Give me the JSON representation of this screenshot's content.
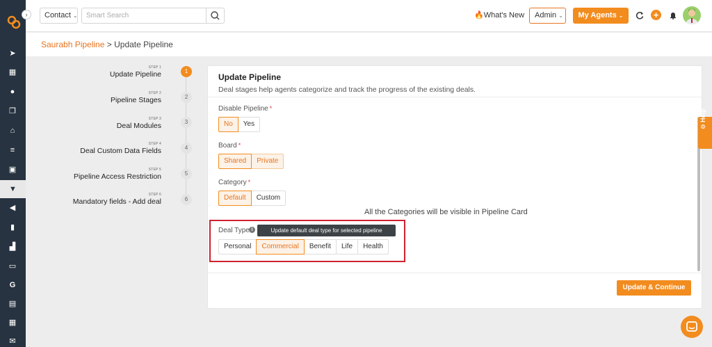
{
  "topbar": {
    "contact_label": "Contact",
    "search_placeholder": "Smart Search",
    "whats_new": "What's New",
    "admin_label": "Admin",
    "my_agents_label": "My Agents"
  },
  "breadcrumb": {
    "parent": "Saurabh Pipeline",
    "separator": ">",
    "current": "Update Pipeline"
  },
  "steps": [
    {
      "step": "STEP 1",
      "title": "Update Pipeline",
      "number": "1",
      "active": true
    },
    {
      "step": "STEP 2",
      "title": "Pipeline Stages",
      "number": "2",
      "active": false
    },
    {
      "step": "STEP 3",
      "title": "Deal Modules",
      "number": "3",
      "active": false
    },
    {
      "step": "STEP 4",
      "title": "Deal Custom Data Fields",
      "number": "4",
      "active": false
    },
    {
      "step": "STEP 5",
      "title": "Pipeline Access Restriction",
      "number": "5",
      "active": false
    },
    {
      "step": "STEP 6",
      "title": "Mandatory fields - Add deal",
      "number": "6",
      "active": false
    }
  ],
  "card": {
    "title": "Update Pipeline",
    "subtitle": "Deal stages help agents categorize and track the progress of the existing deals.",
    "disable_pipeline": {
      "label": "Disable Pipeline",
      "required": "*",
      "options": [
        "No",
        "Yes"
      ],
      "selected": "No"
    },
    "board": {
      "label": "Board",
      "required": "*",
      "options": [
        "Shared",
        "Private"
      ],
      "selected": "Shared"
    },
    "category": {
      "label": "Category",
      "required": "*",
      "options": [
        "Default",
        "Custom"
      ],
      "selected": "Default"
    },
    "categories_note": "All the Categories will be visible in Pipeline Card",
    "deal_type": {
      "label": "Deal Type",
      "tooltip": "Update default deal type for selected pipeline",
      "options": [
        "Personal",
        "Commercial",
        "Benefit",
        "Life",
        "Health"
      ],
      "selected": "Commercial"
    },
    "update_button": "Update & Continue"
  },
  "help_tab": "Help",
  "colors": {
    "accent": "#f28c1e",
    "sidebar": "#273340",
    "highlight": "#d0202f"
  }
}
